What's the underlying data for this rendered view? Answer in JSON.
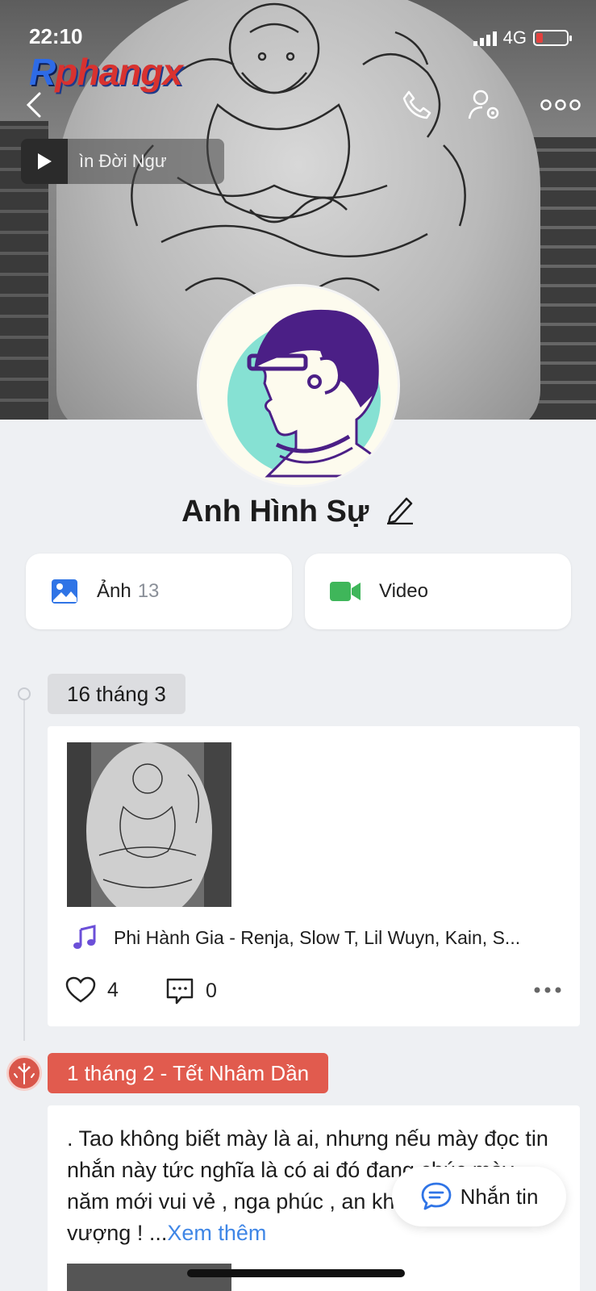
{
  "status_bar": {
    "time": "22:10",
    "network": "4G"
  },
  "watermark": {
    "part1": "R",
    "part2": "phangx"
  },
  "cover": {
    "music_marquee": "ìn Đời      Ngư"
  },
  "profile": {
    "name": "Anh Hình Sự"
  },
  "media": {
    "photos_label": "Ảnh",
    "photos_count": "13",
    "video_label": "Video"
  },
  "timeline": {
    "entry1": {
      "date": "16 tháng 3",
      "song": "Phi Hành Gia - Renja, Slow T, Lil Wuyn, Kain, S...",
      "likes": "4",
      "comments": "0"
    },
    "entry2": {
      "date": "1 tháng 2 - Tết Nhâm Dần",
      "text": ". Tao không biết mày là ai, nhưng nếu mày đọc tin nhắn này tức nghĩa là có ai đó đang chúc mày năm mới vui vẻ , nga           phúc , an khang thịnh vượng ! ...",
      "more": "Xem thêm"
    }
  },
  "message_button": {
    "label": "Nhắn tin"
  },
  "colors": {
    "accent": "#3f86e6",
    "holiday": "#e15b4e",
    "avatar_purple": "#4b1f86",
    "avatar_mint": "#86e1d3"
  }
}
